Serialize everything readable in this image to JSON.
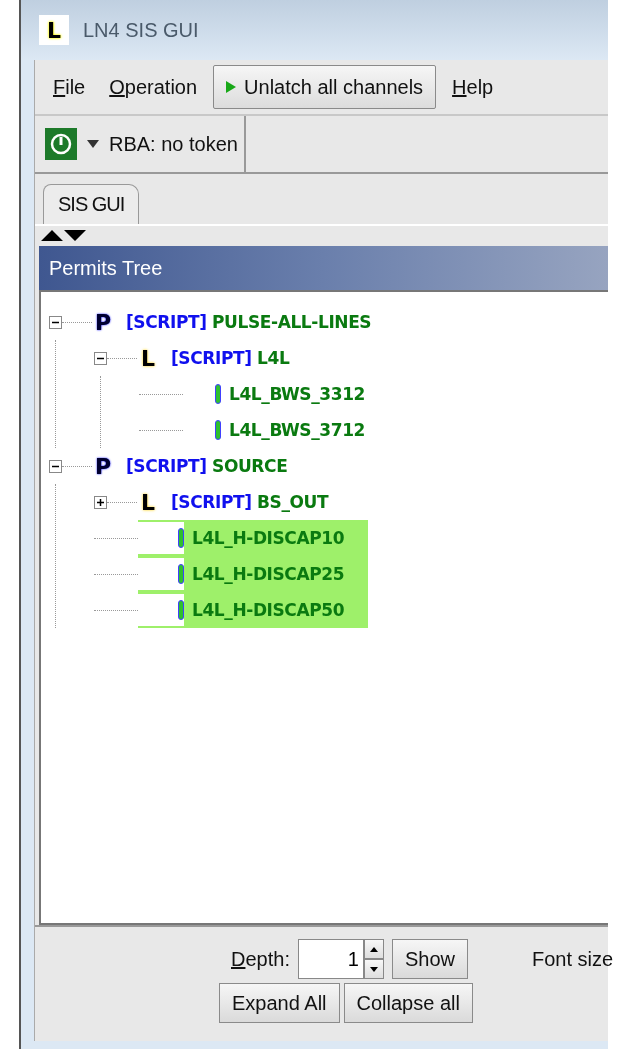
{
  "window": {
    "title": "LN4 SIS GUI",
    "icon_letter": "L"
  },
  "menu": [
    {
      "kind": "menu",
      "label": "File",
      "mnemonic": true
    },
    {
      "kind": "menu",
      "label": "Operation",
      "mnemonic": true
    },
    {
      "kind": "button",
      "label": "Unlatch all channels",
      "mnemonic": false
    },
    {
      "kind": "menu",
      "label": "Help",
      "mnemonic": true
    }
  ],
  "toolbar": {
    "rba_label": "RBA: no token"
  },
  "tabs": [
    {
      "label": "SIS GUI",
      "selected": true
    }
  ],
  "panel": {
    "title": "Permits Tree"
  },
  "tree": [
    {
      "kind": "permit",
      "badge": "P",
      "tag": "[SCRIPT]",
      "label": "PULSE-ALL-LINES",
      "expanded": true,
      "highlighted": false,
      "children": [
        {
          "kind": "line",
          "badge": "L",
          "tag": "[SCRIPT]",
          "label": "L4L",
          "expanded": true,
          "highlighted": false,
          "children": [
            {
              "kind": "channel",
              "label": "L4L_BWS_3312",
              "highlighted": false
            },
            {
              "kind": "channel",
              "label": "L4L_BWS_3712",
              "highlighted": false
            }
          ]
        }
      ]
    },
    {
      "kind": "permit",
      "badge": "P",
      "tag": "[SCRIPT]",
      "label": "SOURCE",
      "expanded": true,
      "highlighted": false,
      "children": [
        {
          "kind": "line",
          "badge": "L",
          "tag": "[SCRIPT]",
          "label": "BS_OUT",
          "expanded": false,
          "highlighted": false
        },
        {
          "kind": "channel",
          "label": "L4L_H-DISCAP10",
          "highlighted": true
        },
        {
          "kind": "channel",
          "label": "L4L_H-DISCAP25",
          "highlighted": true
        },
        {
          "kind": "channel",
          "label": "L4L_H-DISCAP50",
          "highlighted": true
        }
      ]
    }
  ],
  "controls": {
    "depth_label": "Depth:",
    "depth_value": "1",
    "show": "Show",
    "font_size_label": "Font size",
    "expand_all": "Expand All",
    "collapse_all": "Collapse all"
  }
}
